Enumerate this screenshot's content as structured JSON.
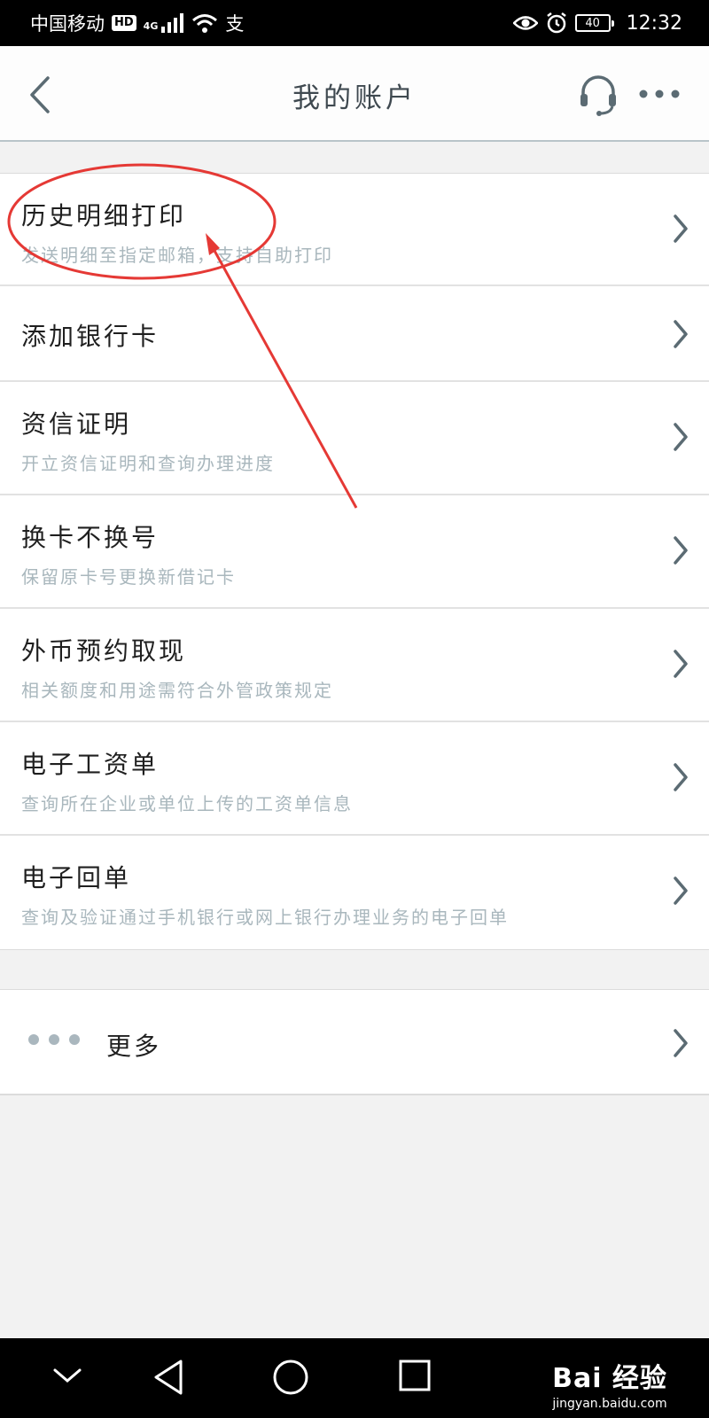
{
  "status_bar": {
    "carrier": "中国移动",
    "hd": "HD",
    "network": "4G",
    "pay_icon": "支",
    "battery": "40",
    "time": "12:32"
  },
  "header": {
    "title": "我的账户"
  },
  "list": [
    {
      "title": "历史明细打印",
      "subtitle": "发送明细至指定邮箱，支持自助打印"
    },
    {
      "title": "添加银行卡"
    },
    {
      "title": "资信证明",
      "subtitle": "开立资信证明和查询办理进度"
    },
    {
      "title": "换卡不换号",
      "subtitle": "保留原卡号更换新借记卡"
    },
    {
      "title": "外币预约取现",
      "subtitle": "相关额度和用途需符合外管政策规定"
    },
    {
      "title": "电子工资单",
      "subtitle": "查询所在企业或单位上传的工资单信息"
    },
    {
      "title": "电子回单",
      "subtitle": "查询及验证通过手机银行或网上银行办理业务的电子回单"
    }
  ],
  "more": {
    "label": "更多"
  },
  "watermark": {
    "brand": "Bai 经验",
    "url": "jingyan.baidu.com"
  },
  "colors": {
    "annotation": "#e53935",
    "subtitle": "#a9b7bd",
    "header_text": "#3f4950"
  }
}
